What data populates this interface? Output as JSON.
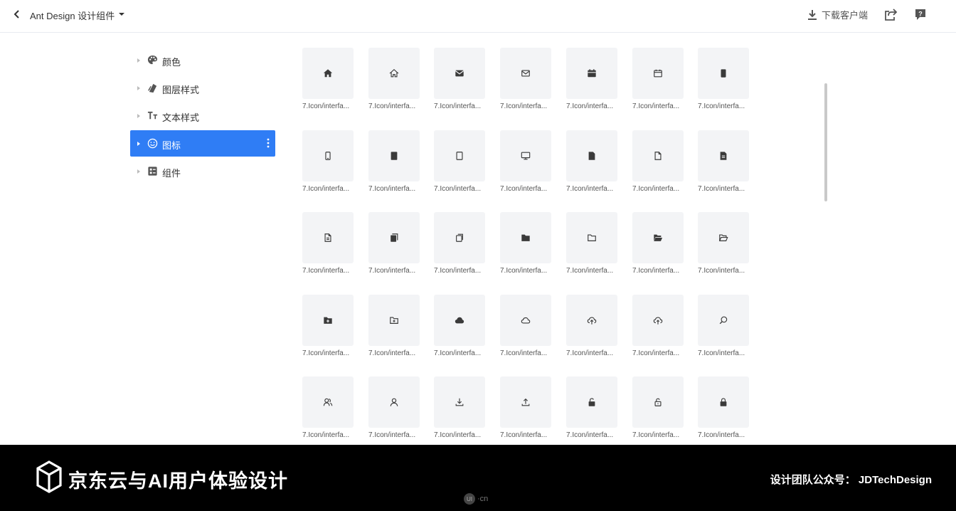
{
  "header": {
    "project_title": "Ant Design 设计组件",
    "download_label": "下载客户端"
  },
  "tree": {
    "items": [
      {
        "label": "颜色",
        "icon": "palette-icon",
        "active": false
      },
      {
        "label": "图层样式",
        "icon": "layers-icon",
        "active": false
      },
      {
        "label": "文本样式",
        "icon": "text-style-icon",
        "active": false
      },
      {
        "label": "图标",
        "icon": "smile-icon",
        "active": true
      },
      {
        "label": "组件",
        "icon": "component-icon",
        "active": false
      }
    ]
  },
  "icon_grid": {
    "caption": "7.Icon/interfa...",
    "rows": [
      [
        "home-filled-icon",
        "home-outline-icon",
        "mail-filled-icon",
        "mail-outline-icon",
        "calendar-filled-icon",
        "calendar-outline-icon",
        "mobile-filled-icon"
      ],
      [
        "mobile-outline-icon",
        "tablet-filled-icon",
        "tablet-outline-icon",
        "desktop-icon",
        "file-filled-icon",
        "file-outline-icon",
        "file-text-filled-icon"
      ],
      [
        "file-text-outline-icon",
        "copy-filled-icon",
        "copy-outline-icon",
        "folder-filled-icon",
        "folder-outline-icon",
        "folder-open-filled-icon",
        "folder-open-outline-icon"
      ],
      [
        "folder-add-filled-icon",
        "folder-add-outline-icon",
        "cloud-filled-icon",
        "cloud-outline-icon",
        "cloud-upload-filled-icon",
        "cloud-upload-outline-icon",
        "search-icon"
      ],
      [
        "team-icon",
        "user-icon",
        "download-icon",
        "upload-icon",
        "unlock-filled-icon",
        "unlock-outline-icon",
        "lock-filled-icon"
      ]
    ]
  },
  "footer": {
    "brand": "京东云与AI用户体验设计",
    "wechat": "设计团队公众号： JDTechDesign",
    "watermark": "·cn",
    "watermark_badge": "UI"
  },
  "colors": {
    "accent": "#2f7df5",
    "tile_bg": "#f3f4f6",
    "icon": "#3a3a3a",
    "footer_bg": "#000000"
  }
}
